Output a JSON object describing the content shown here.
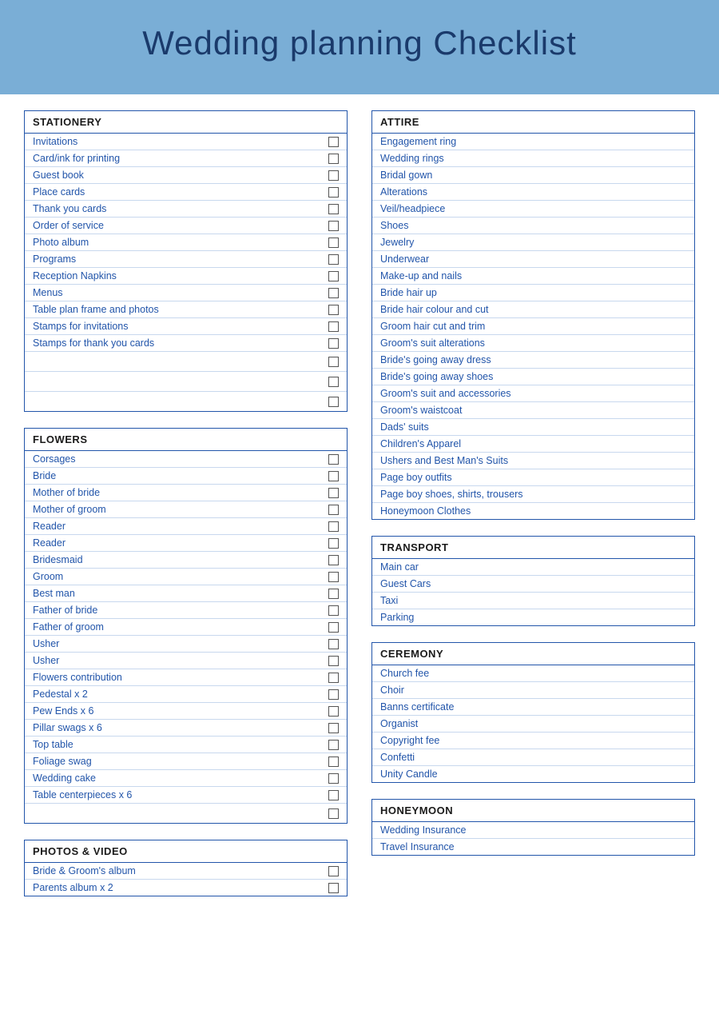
{
  "header": {
    "title": "Wedding planning Checklist"
  },
  "sections": [
    {
      "id": "stationery",
      "title": "STATIONERY",
      "items": [
        {
          "label": "Invitations",
          "checkbox": true
        },
        {
          "label": "Card/ink for printing",
          "checkbox": true
        },
        {
          "label": "Guest book",
          "checkbox": true
        },
        {
          "label": "Place cards",
          "checkbox": true
        },
        {
          "label": "Thank you cards",
          "checkbox": true
        },
        {
          "label": "Order of service",
          "checkbox": true
        },
        {
          "label": "Photo album",
          "checkbox": true
        },
        {
          "label": "Programs",
          "checkbox": true
        },
        {
          "label": "Reception Napkins",
          "checkbox": true
        },
        {
          "label": "Menus",
          "checkbox": true
        },
        {
          "label": "Table plan frame and photos",
          "checkbox": true
        },
        {
          "label": "Stamps for invitations",
          "checkbox": true
        },
        {
          "label": "Stamps for thank you cards",
          "checkbox": true
        },
        {
          "label": "",
          "checkbox": true
        },
        {
          "label": "",
          "checkbox": true
        },
        {
          "label": "",
          "checkbox": true
        }
      ]
    },
    {
      "id": "attire",
      "title": "ATTIRE",
      "items": [
        {
          "label": "Engagement ring",
          "checkbox": false
        },
        {
          "label": "Wedding rings",
          "checkbox": false
        },
        {
          "label": "Bridal gown",
          "checkbox": false
        },
        {
          "label": "Alterations",
          "checkbox": false
        },
        {
          "label": "Veil/headpiece",
          "checkbox": false
        },
        {
          "label": "Shoes",
          "checkbox": false
        },
        {
          "label": "Jewelry",
          "checkbox": false
        },
        {
          "label": "Underwear",
          "checkbox": false
        },
        {
          "label": "Make-up and nails",
          "checkbox": false
        },
        {
          "label": "Bride hair up",
          "checkbox": false
        },
        {
          "label": "Bride hair colour and cut",
          "checkbox": false
        },
        {
          "label": "Groom hair cut and trim",
          "checkbox": false
        },
        {
          "label": "Groom's suit alterations",
          "checkbox": false
        },
        {
          "label": "Bride's going away dress",
          "checkbox": false
        },
        {
          "label": "Bride's going away shoes",
          "checkbox": false
        },
        {
          "label": "Groom's suit and accessories",
          "checkbox": false
        },
        {
          "label": "Groom's waistcoat",
          "checkbox": false
        },
        {
          "label": "Dads' suits",
          "checkbox": false
        },
        {
          "label": "Children's Apparel",
          "checkbox": false
        },
        {
          "label": "Ushers and Best Man's Suits",
          "checkbox": false
        },
        {
          "label": "Page boy outfits",
          "checkbox": false
        },
        {
          "label": "Page boy shoes, shirts, trousers",
          "checkbox": false
        },
        {
          "label": "Honeymoon Clothes",
          "checkbox": false
        }
      ]
    },
    {
      "id": "flowers",
      "title": "FLOWERS",
      "items": [
        {
          "label": "Corsages",
          "checkbox": true
        },
        {
          "label": "Bride",
          "checkbox": true
        },
        {
          "label": "Mother of bride",
          "checkbox": true
        },
        {
          "label": "Mother of groom",
          "checkbox": true
        },
        {
          "label": "Reader",
          "checkbox": true
        },
        {
          "label": "Reader",
          "checkbox": true
        },
        {
          "label": "Bridesmaid",
          "checkbox": true
        },
        {
          "label": "Groom",
          "checkbox": true
        },
        {
          "label": "Best man",
          "checkbox": true
        },
        {
          "label": "Father of bride",
          "checkbox": true
        },
        {
          "label": "Father of groom",
          "checkbox": true
        },
        {
          "label": "Usher",
          "checkbox": true
        },
        {
          "label": "Usher",
          "checkbox": true
        },
        {
          "label": "Flowers contribution",
          "checkbox": true
        },
        {
          "label": "Pedestal x 2",
          "checkbox": true
        },
        {
          "label": "Pew Ends x 6",
          "checkbox": true
        },
        {
          "label": "Pillar swags x 6",
          "checkbox": true
        },
        {
          "label": "Top table",
          "checkbox": true
        },
        {
          "label": "Foliage swag",
          "checkbox": true
        },
        {
          "label": "Wedding cake",
          "checkbox": true
        },
        {
          "label": "Table centerpieces x 6",
          "checkbox": true
        },
        {
          "label": "",
          "checkbox": true
        }
      ]
    },
    {
      "id": "transport",
      "title": "TRANSPORT",
      "items": [
        {
          "label": "Main car",
          "checkbox": false
        },
        {
          "label": "Guest Cars",
          "checkbox": false
        },
        {
          "label": "Taxi",
          "checkbox": false
        },
        {
          "label": "Parking",
          "checkbox": false
        }
      ]
    },
    {
      "id": "photos-video",
      "title": "PHOTOS & VIDEO",
      "items": [
        {
          "label": "Bride & Groom's album",
          "checkbox": true
        },
        {
          "label": "Parents album x 2",
          "checkbox": true
        }
      ]
    },
    {
      "id": "ceremony",
      "title": "CEREMONY",
      "items": [
        {
          "label": "Church fee",
          "checkbox": false
        },
        {
          "label": "Choir",
          "checkbox": false
        },
        {
          "label": "Banns certificate",
          "checkbox": false
        },
        {
          "label": "Organist",
          "checkbox": false
        },
        {
          "label": "Copyright fee",
          "checkbox": false
        },
        {
          "label": "Confetti",
          "checkbox": false
        },
        {
          "label": "Unity Candle",
          "checkbox": false
        }
      ]
    },
    {
      "id": "honeymoon",
      "title": "HONEYMOON",
      "items": [
        {
          "label": "Wedding Insurance",
          "checkbox": false
        },
        {
          "label": "Travel Insurance",
          "checkbox": false
        }
      ]
    }
  ]
}
